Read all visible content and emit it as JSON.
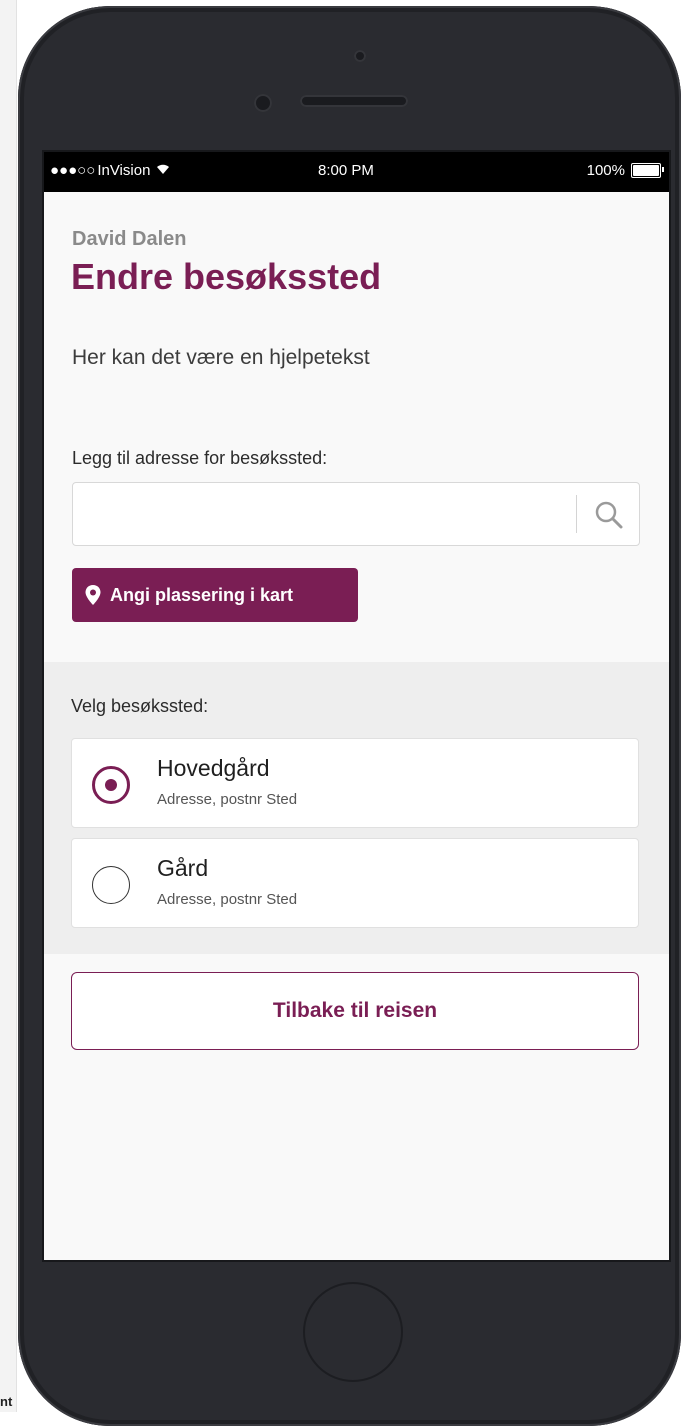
{
  "corner_text": "nt",
  "status_bar": {
    "signal": "●●●○○",
    "carrier": "InVision",
    "wifi_glyph": "wifi-icon",
    "time": "8:00 PM",
    "battery_percent": "100%"
  },
  "header": {
    "user_name": "David Dalen",
    "title": "Endre besøkssted"
  },
  "help_text": "Her kan det være en hjelpetekst",
  "address": {
    "label": "Legg til adresse for besøkssted:",
    "value": "",
    "placeholder": ""
  },
  "map_button_label": "Angi plassering i kart",
  "choose": {
    "label": "Velg besøkssted:",
    "options": [
      {
        "title": "Hovedgård",
        "subtitle": "Adresse, postnr Sted",
        "selected": true
      },
      {
        "title": "Gård",
        "subtitle": "Adresse, postnr Sted",
        "selected": false
      }
    ]
  },
  "back_button_label": "Tilbake til reisen",
  "colors": {
    "accent": "#7a1e54",
    "background": "#f9f9f9",
    "section_bg": "#eeeeee"
  }
}
